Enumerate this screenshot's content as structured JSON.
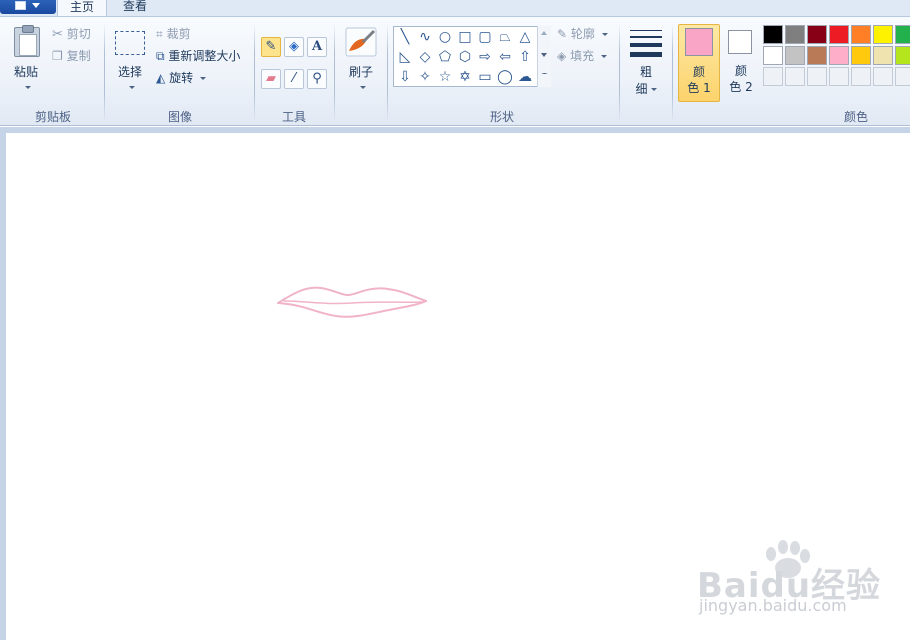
{
  "tabs": {
    "home": "主页",
    "view": "查看"
  },
  "clipboard": {
    "paste": "粘贴",
    "cut": "剪切",
    "copy": "复制",
    "label": "剪贴板"
  },
  "image": {
    "select": "选择",
    "crop": "裁剪",
    "resize": "重新调整大小",
    "rotate": "旋转",
    "label": "图像"
  },
  "tools": {
    "label": "工具",
    "text_tool": "A"
  },
  "brushes": {
    "label": "刷子"
  },
  "shapes": {
    "outline": "轮廓",
    "fill": "填充",
    "label": "形状"
  },
  "size": {
    "label_line1": "粗",
    "label_line2": "细"
  },
  "colors": {
    "color1_line1": "颜",
    "color1_line2": "色 1",
    "color2_line1": "颜",
    "color2_line2": "色 2",
    "label": "颜色",
    "color1_value": "#f9a6c6",
    "color2_value": "#ffffff",
    "palette_row1": [
      "#000000",
      "#7f7f7f",
      "#880015",
      "#ed1c24",
      "#ff7f27",
      "#fff200",
      "#22b14c"
    ],
    "palette_row2": [
      "#ffffff",
      "#c3c3c3",
      "#b97a57",
      "#ffaec9",
      "#ffc90e",
      "#efe4b0",
      "#b5e61d"
    ]
  },
  "canvas": {
    "stroke_color": "#f0b3c8"
  },
  "watermark": {
    "text": "Baidu经验",
    "url": "jingyan.baidu.com"
  }
}
